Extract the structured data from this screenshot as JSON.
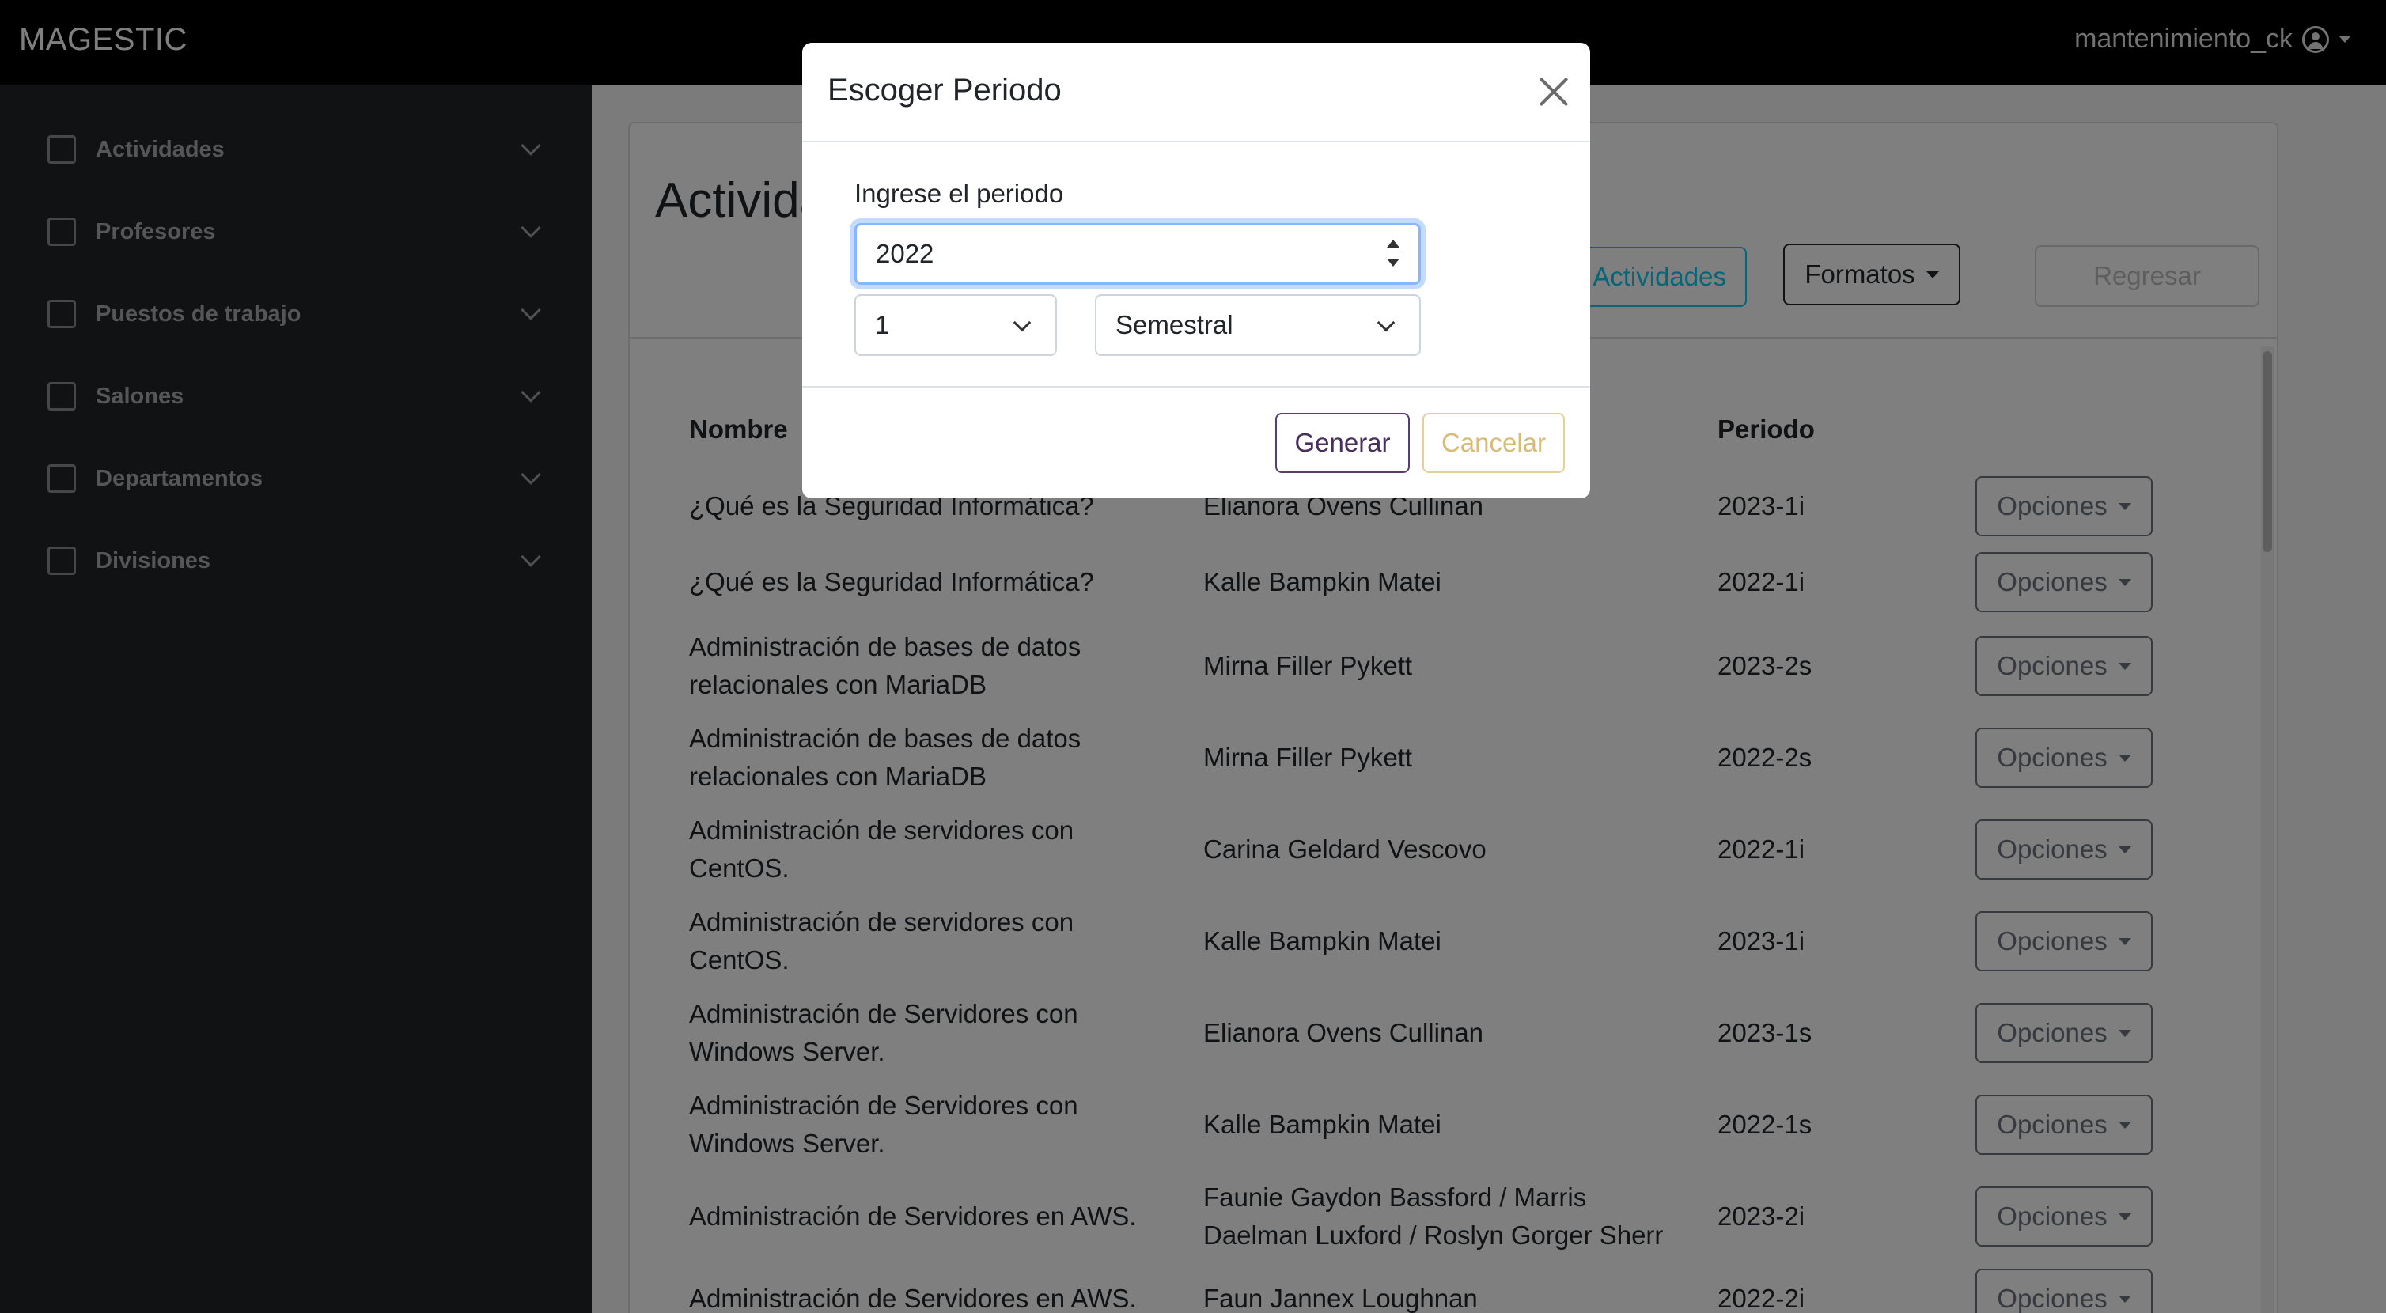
{
  "navbar": {
    "brand": "MAGESTIC",
    "username": "mantenimiento_ck"
  },
  "sidebar": {
    "items": [
      {
        "label": "Actividades",
        "icon": "clipboard-icon"
      },
      {
        "label": "Profesores",
        "icon": "users-icon"
      },
      {
        "label": "Puestos de trabajo",
        "icon": "building-icon"
      },
      {
        "label": "Salones",
        "icon": "chart-icon"
      },
      {
        "label": "Departamentos",
        "icon": "bank-icon"
      },
      {
        "label": "Divisiones",
        "icon": "briefcase-icon"
      }
    ]
  },
  "main": {
    "title": "Activida",
    "buttons": {
      "actividades": "Actividades",
      "formatos": "Formatos",
      "regresar": "Regresar"
    },
    "table": {
      "headers": {
        "nombre": "Nombre",
        "periodo": "Periodo"
      },
      "option_label": "Opciones",
      "rows": [
        {
          "nombre": [
            "¿Qué es la Seguridad Informática?"
          ],
          "profesor": [
            "Elianora Ovens Cullinan"
          ],
          "periodo": "2023-1i"
        },
        {
          "nombre": [
            "¿Qué es la Seguridad Informática?"
          ],
          "profesor": [
            "Kalle Bampkin Matei"
          ],
          "periodo": "2022-1i"
        },
        {
          "nombre": [
            "Administración de bases de datos",
            "relacionales con MariaDB"
          ],
          "profesor": [
            "Mirna Filler Pykett"
          ],
          "periodo": "2023-2s"
        },
        {
          "nombre": [
            "Administración de bases de datos",
            "relacionales con MariaDB"
          ],
          "profesor": [
            "Mirna Filler Pykett"
          ],
          "periodo": "2022-2s"
        },
        {
          "nombre": [
            "Administración de servidores con",
            "CentOS."
          ],
          "profesor": [
            "Carina Geldard Vescovo"
          ],
          "periodo": "2022-1i"
        },
        {
          "nombre": [
            "Administración de servidores con",
            "CentOS."
          ],
          "profesor": [
            "Kalle Bampkin Matei"
          ],
          "periodo": "2023-1i"
        },
        {
          "nombre": [
            "Administración de Servidores con",
            "Windows Server."
          ],
          "profesor": [
            "Elianora Ovens Cullinan"
          ],
          "periodo": "2023-1s"
        },
        {
          "nombre": [
            "Administración de Servidores con",
            "Windows Server."
          ],
          "profesor": [
            "Kalle Bampkin Matei"
          ],
          "periodo": "2022-1s"
        },
        {
          "nombre": [
            "Administración de Servidores en AWS."
          ],
          "profesor": [
            "Faunie Gaydon Bassford / Marris",
            "Daelman Luxford / Roslyn Gorger Sherr"
          ],
          "periodo": "2023-2i"
        },
        {
          "nombre": [
            "Administración de Servidores en AWS."
          ],
          "profesor": [
            "Faun Jannex Loughnan"
          ],
          "periodo": "2022-2i"
        }
      ]
    }
  },
  "modal": {
    "title": "Escoger Periodo",
    "label": "Ingrese el periodo",
    "year_value": "2022",
    "number_value": "1",
    "type_value": "Semestral",
    "generar": "Generar",
    "cancelar": "Cancelar"
  }
}
